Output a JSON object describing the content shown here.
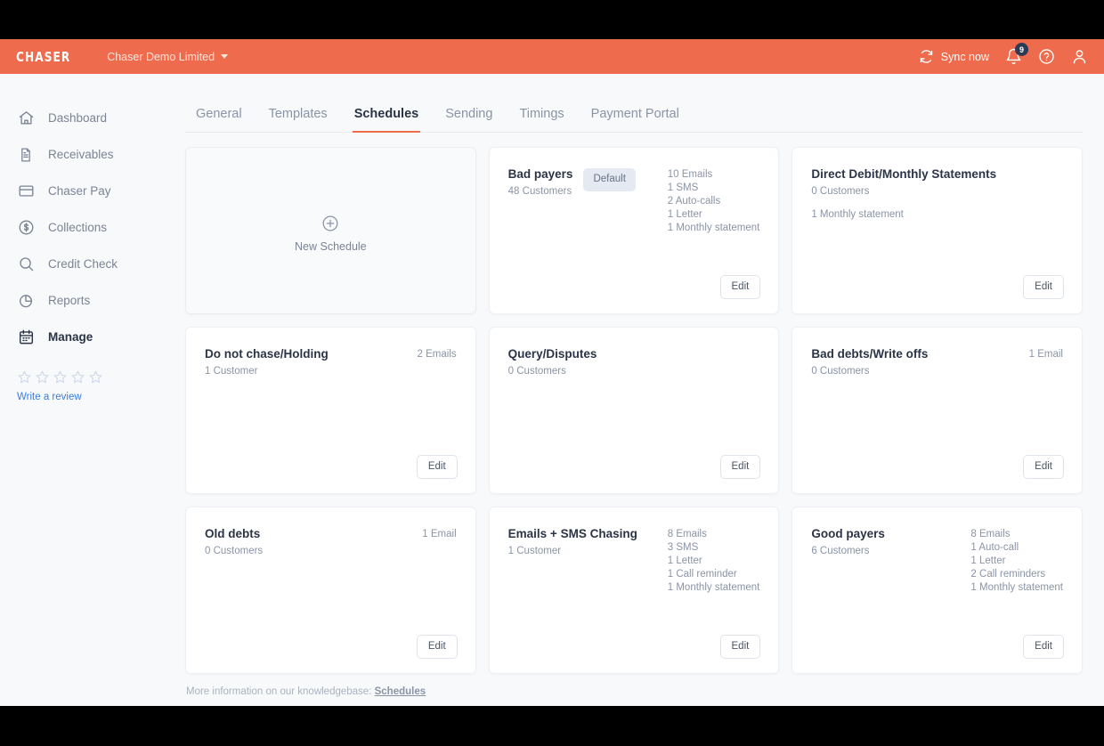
{
  "topbar": {
    "brand": "CHASER",
    "org": "Chaser Demo Limited",
    "sync_label": "Sync now",
    "notification_count": "9",
    "accent_color": "#ee6c4d",
    "badge_color": "#2b3a55"
  },
  "sidebar": {
    "items": [
      {
        "label": "Dashboard",
        "icon": "home-icon",
        "active": false
      },
      {
        "label": "Receivables",
        "icon": "document-icon",
        "active": false
      },
      {
        "label": "Chaser Pay",
        "icon": "card-icon",
        "active": false
      },
      {
        "label": "Collections",
        "icon": "dollar-circle-icon",
        "active": false
      },
      {
        "label": "Credit Check",
        "icon": "search-icon",
        "active": false
      },
      {
        "label": "Reports",
        "icon": "pie-chart-icon",
        "active": false
      },
      {
        "label": "Manage",
        "icon": "calendar-icon",
        "active": true
      }
    ],
    "review": {
      "stars": 5,
      "link_label": "Write a review",
      "link_color": "#3b7ddd"
    }
  },
  "tabs": [
    {
      "label": "General",
      "active": false
    },
    {
      "label": "Templates",
      "active": false
    },
    {
      "label": "Schedules",
      "active": true
    },
    {
      "label": "Sending",
      "active": false
    },
    {
      "label": "Timings",
      "active": false
    },
    {
      "label": "Payment Portal",
      "active": false
    }
  ],
  "new_schedule": {
    "label": "New Schedule",
    "icon": "plus-circle-icon"
  },
  "edit_label": "Edit",
  "default_badge_label": "Default",
  "cards": [
    {
      "title": "Bad payers",
      "customers": "48 Customers",
      "is_default": true,
      "stats": [
        "10 Emails",
        "1 SMS",
        "2 Auto-calls",
        "1 Letter",
        "1 Monthly statement"
      ],
      "stats_position": "right"
    },
    {
      "title": "Direct Debit/Monthly Statements",
      "customers": "0 Customers",
      "is_default": false,
      "stats": [
        "1 Monthly statement"
      ],
      "stats_position": "below"
    },
    {
      "title": "Do not chase/Holding",
      "customers": "1 Customer",
      "is_default": false,
      "stats": [
        "2 Emails"
      ],
      "stats_position": "right"
    },
    {
      "title": "Query/Disputes",
      "customers": "0 Customers",
      "is_default": false,
      "stats": [],
      "stats_position": "right"
    },
    {
      "title": "Bad debts/Write offs",
      "customers": "0 Customers",
      "is_default": false,
      "stats": [
        "1 Email"
      ],
      "stats_position": "right"
    },
    {
      "title": "Old debts",
      "customers": "0 Customers",
      "is_default": false,
      "stats": [
        "1 Email"
      ],
      "stats_position": "right"
    },
    {
      "title": "Emails + SMS Chasing",
      "customers": "1 Customer",
      "is_default": false,
      "stats": [
        "8 Emails",
        "3 SMS",
        "1 Letter",
        "1 Call reminder",
        "1 Monthly statement"
      ],
      "stats_position": "right"
    },
    {
      "title": "Good payers",
      "customers": "6 Customers",
      "is_default": false,
      "stats": [
        "8 Emails",
        "1 Auto-call",
        "1 Letter",
        "2 Call reminders",
        "1 Monthly statement"
      ],
      "stats_position": "right"
    }
  ],
  "footer": {
    "text": "More information on our knowledgebase:",
    "link_label": "Schedules"
  }
}
